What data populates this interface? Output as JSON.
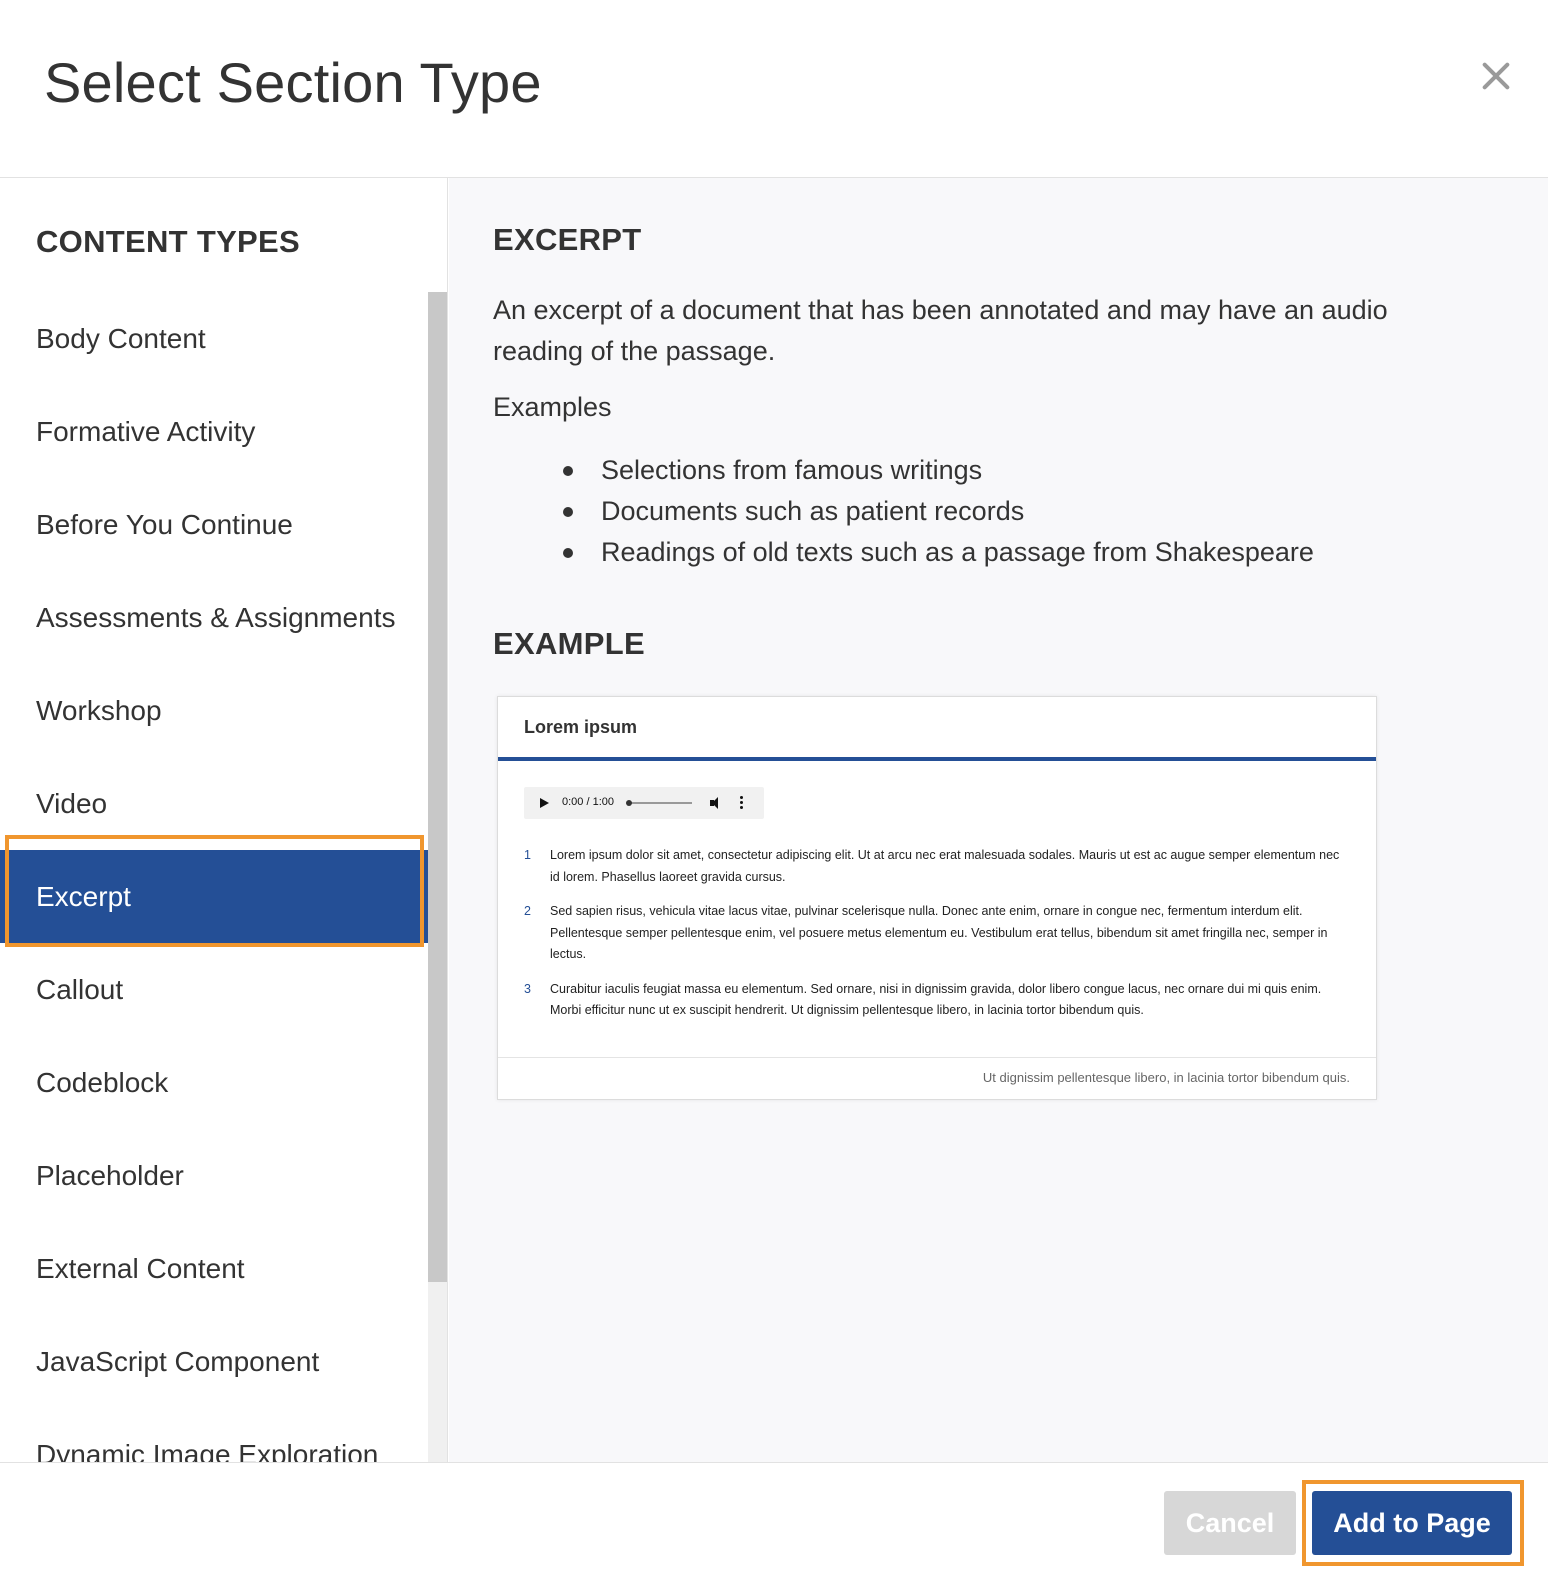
{
  "modal": {
    "title": "Select Section Type",
    "close_icon": "close-icon"
  },
  "sidebar": {
    "heading": "CONTENT TYPES",
    "selected_index": 6,
    "items": [
      {
        "label": "Body Content"
      },
      {
        "label": "Formative Activity"
      },
      {
        "label": "Before You Continue"
      },
      {
        "label": "Assessments & Assignments"
      },
      {
        "label": "Workshop"
      },
      {
        "label": "Video"
      },
      {
        "label": "Excerpt"
      },
      {
        "label": "Callout"
      },
      {
        "label": "Codeblock"
      },
      {
        "label": "Placeholder"
      },
      {
        "label": "External Content"
      },
      {
        "label": "JavaScript Component"
      },
      {
        "label": "Dynamic Image Exploration"
      }
    ]
  },
  "detail": {
    "heading": "EXCERPT",
    "description": "An excerpt of a document that has been annotated and may have an audio reading of the passage.",
    "examples_label": "Examples",
    "examples": [
      "Selections from famous writings",
      "Documents such as patient records",
      "Readings of old texts such as a passage from Shakespeare"
    ],
    "example_heading": "EXAMPLE"
  },
  "preview": {
    "title": "Lorem ipsum",
    "audio_time": "0:00 / 1:00",
    "lines": [
      {
        "num": "1",
        "text": "Lorem ipsum dolor sit amet, consectetur adipiscing elit. Ut at arcu nec erat malesuada sodales. Mauris ut est ac augue semper elementum nec id lorem. Phasellus laoreet gravida cursus."
      },
      {
        "num": "2",
        "text": "Sed sapien risus, vehicula vitae lacus vitae, pulvinar scelerisque nulla. Donec ante enim, ornare in congue nec, fermentum interdum elit. Pellentesque semper pellentesque enim, vel posuere metus elementum eu. Vestibulum erat tellus, bibendum sit amet fringilla nec, semper in lectus."
      },
      {
        "num": "3",
        "text": "Curabitur iaculis feugiat massa eu elementum. Sed ornare, nisi in dignissim gravida, dolor libero congue lacus, nec ornare dui mi quis enim. Morbi efficitur nunc ut ex suscipit hendrerit. Ut dignissim pellentesque libero, in lacinia tortor bibendum quis."
      }
    ],
    "caption": "Ut dignissim pellentesque libero, in lacinia tortor bibendum quis."
  },
  "footer": {
    "cancel_label": "Cancel",
    "add_label": "Add to Page"
  },
  "colors": {
    "accent": "#244f96",
    "highlight_outline": "#f0962e",
    "cancel_disabled": "#d7d7d7"
  }
}
